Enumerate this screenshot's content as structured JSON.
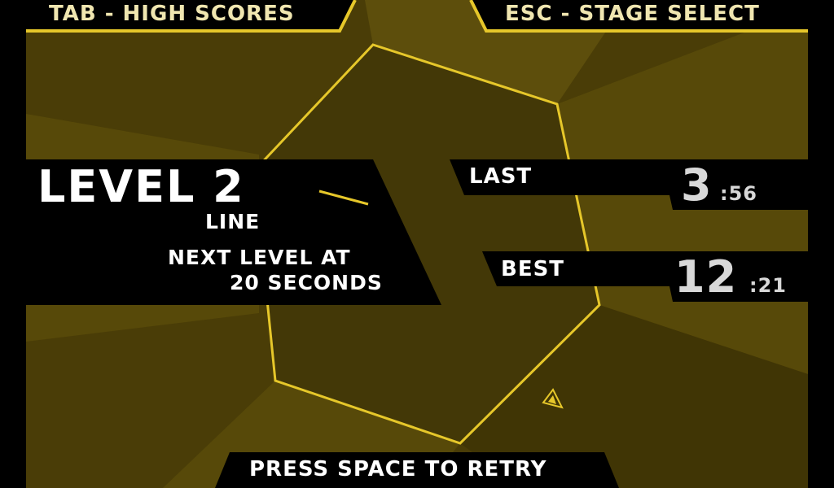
{
  "colors": {
    "bg_dark": "#4a3d07",
    "bg_light": "#5d4e0c",
    "accent": "#e6c72a",
    "panel": "#000000",
    "hex_stroke": "#e6c72a"
  },
  "header": {
    "high_scores": "TAB - HIGH SCORES",
    "stage_select": "ESC - STAGE SELECT"
  },
  "level": {
    "title": "LEVEL 2",
    "name": "LINE",
    "next_line1": "NEXT LEVEL AT",
    "next_line2": "20 SECONDS"
  },
  "scores": {
    "last_label": "LAST",
    "last_major": "3",
    "last_minor": ":56",
    "best_label": "BEST",
    "best_major": "12",
    "best_minor": ":21"
  },
  "footer": {
    "retry": "PRESS SPACE TO RETRY"
  },
  "icons": {
    "player": "triangle-cursor-icon",
    "level_preview": "line-shape-icon"
  }
}
